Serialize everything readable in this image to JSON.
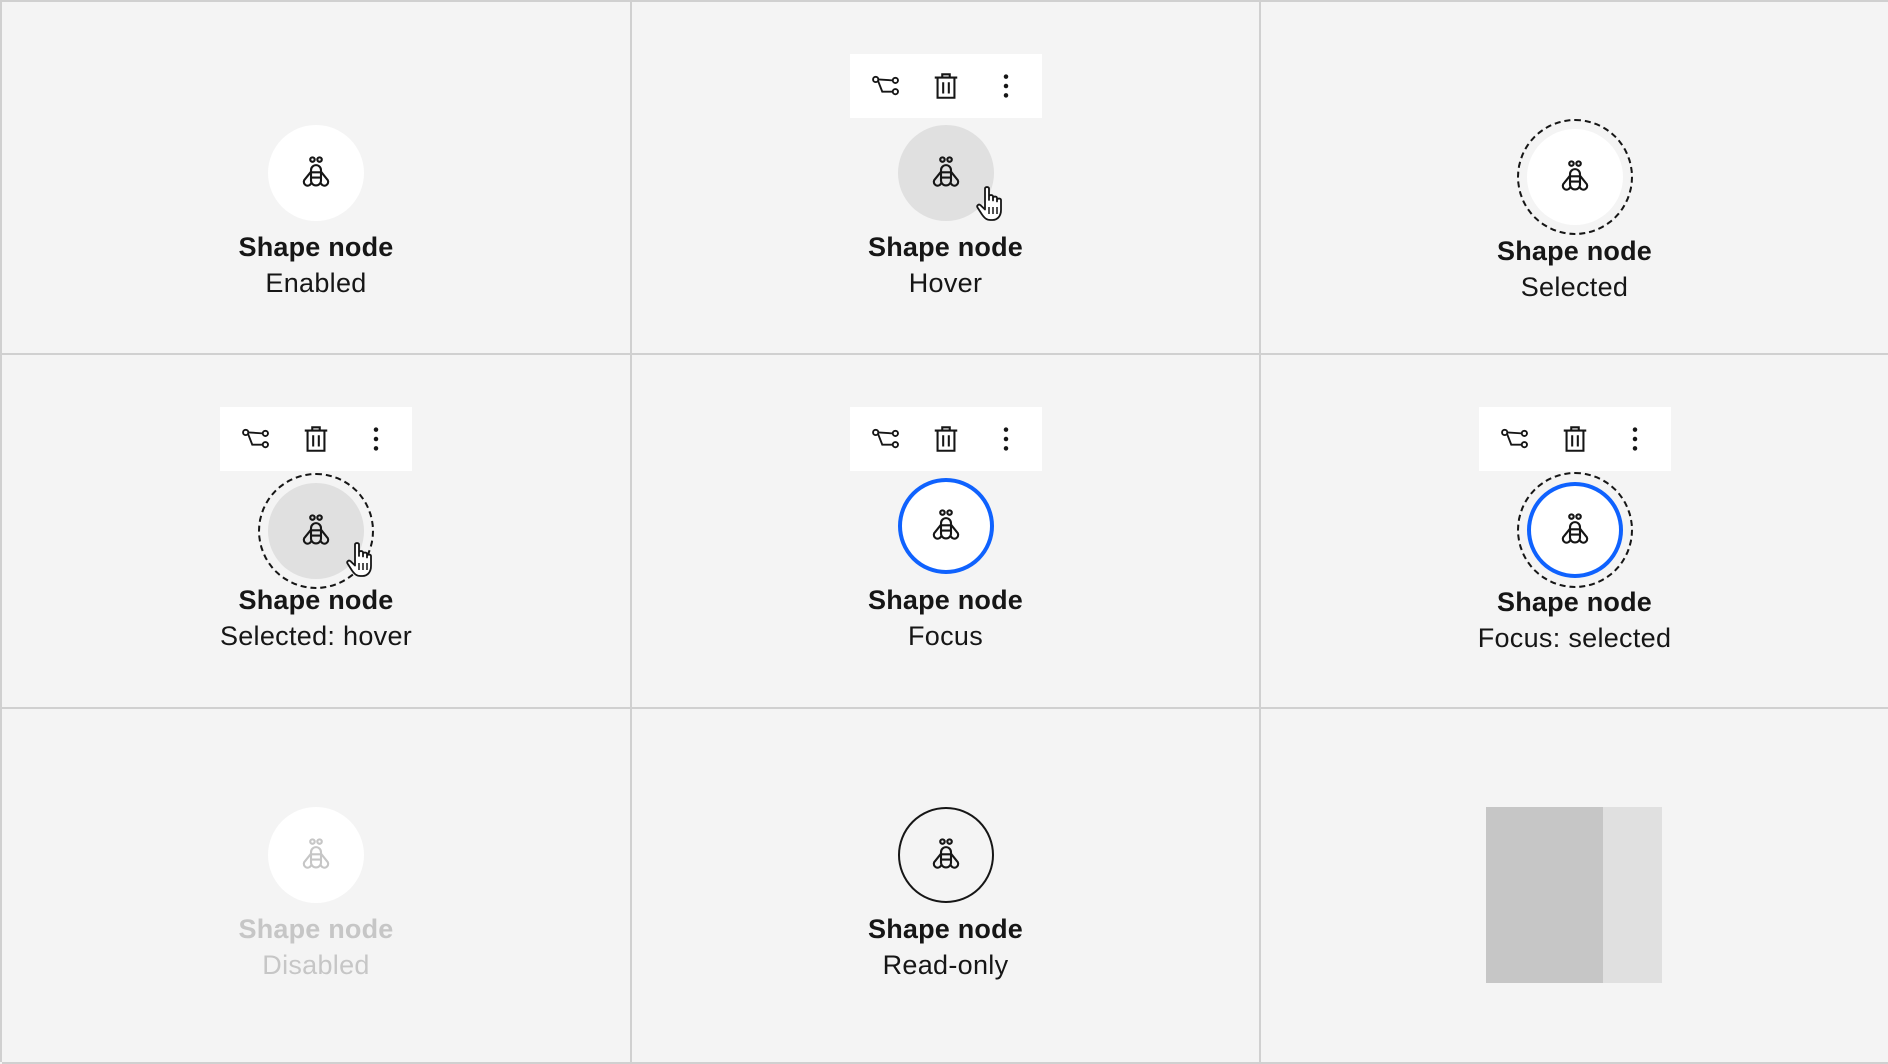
{
  "colors": {
    "background": "#f4f4f4",
    "grid_line": "#d0d0d0",
    "node_fill": "#ffffff",
    "hover_fill": "#e0e0e0",
    "focus": "#0f62fe",
    "text": "#161616",
    "disabled_text": "#c6c6c6",
    "skeleton_dark": "#c6c6c6",
    "skeleton_light": "#e0e0e0"
  },
  "icons": {
    "node": "bee-icon",
    "toolbar": [
      "connect-icon",
      "trash-can-icon",
      "overflow-menu-vertical-icon"
    ],
    "pointer": "hand-pointer-cursor"
  },
  "cells": [
    {
      "title": "Shape node",
      "state": "Enabled"
    },
    {
      "title": "Shape node",
      "state": "Hover"
    },
    {
      "title": "Shape node",
      "state": "Selected"
    },
    {
      "title": "Shape node",
      "state": "Selected: hover"
    },
    {
      "title": "Shape node",
      "state": "Focus"
    },
    {
      "title": "Shape node",
      "state": "Focus: selected"
    },
    {
      "title": "Shape node",
      "state": "Disabled"
    },
    {
      "title": "Shape node",
      "state": "Read-only"
    }
  ]
}
